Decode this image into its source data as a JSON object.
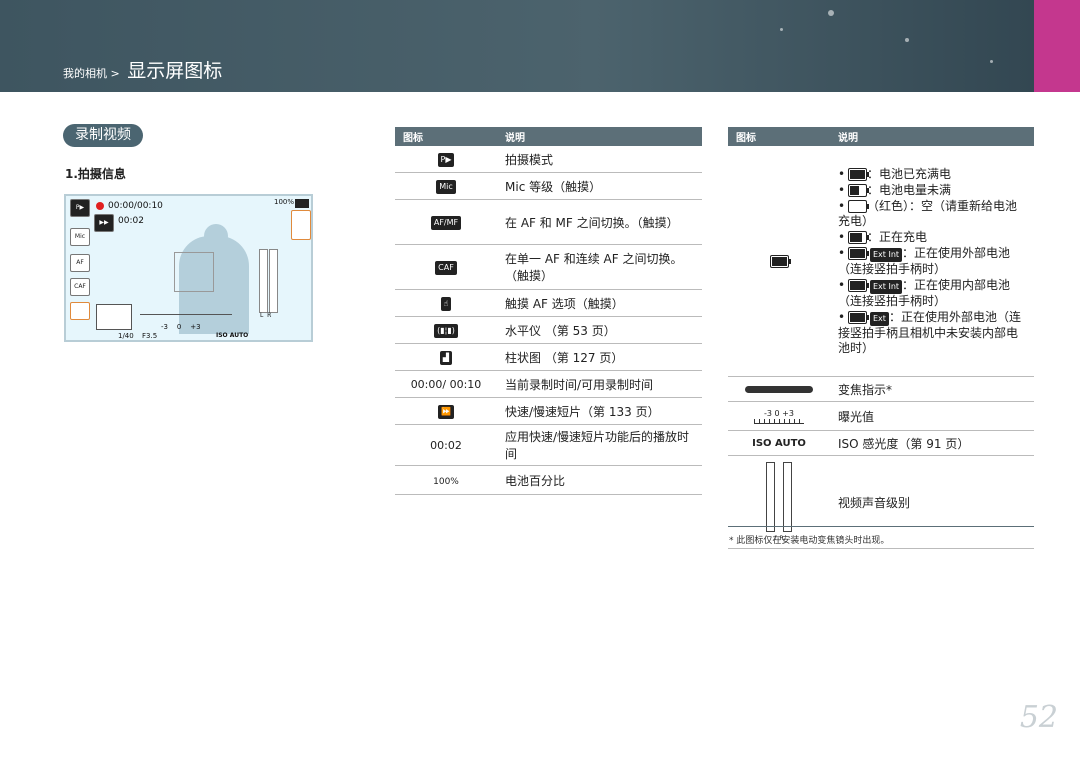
{
  "header": {
    "breadcrumb_small": "我的相机 >",
    "breadcrumb_big": "显示屏图标"
  },
  "section": {
    "title": "录制视频",
    "subtitle": "1.拍摄信息"
  },
  "screen": {
    "time_rec": "00:00/00:10",
    "time_clip": "00:02",
    "battery_pct": "100%",
    "shutter": "1/40",
    "aperture": "F3.5",
    "ev_scale": [
      "-3",
      "0",
      "+3"
    ],
    "iso": "ISO AUTO",
    "level_labels": [
      "L",
      "R"
    ]
  },
  "table_left": {
    "headers": [
      "图标",
      "说明"
    ],
    "rows": [
      {
        "icon": "P▶",
        "icon_name": "movie-mode-icon",
        "desc": "拍摄模式"
      },
      {
        "icon": "Mic",
        "icon_name": "mic-icon",
        "desc": "Mic 等级（触摸）"
      },
      {
        "icon": "AF/MF",
        "icon_name": "af-mf-icon",
        "desc": "在 AF 和 MF 之间切换。（触摸）"
      },
      {
        "icon": "CAF",
        "icon_name": "caf-icon",
        "desc": "在单一 AF 和连续 AF 之间切换。（触摸）"
      },
      {
        "icon": "☝",
        "icon_name": "touch-af-icon",
        "desc": "触摸 AF 选项（触摸）"
      },
      {
        "icon": "(▮¦▮)",
        "icon_name": "level-icon",
        "desc": "水平仪 （第 53 页）"
      },
      {
        "icon": "▟",
        "icon_name": "histogram-icon",
        "desc": "柱状图 （第 127 页）"
      },
      {
        "icon": "00:00/ 00:10",
        "icon_name": "rec-time-text",
        "desc": "当前录制时间/可用录制时间"
      },
      {
        "icon": "⏩",
        "icon_name": "fast-slow-icon",
        "desc": "快速/慢速短片（第 133 页）"
      },
      {
        "icon": "00:02",
        "icon_name": "clip-time-text",
        "desc": "应用快速/慢速短片功能后的播放时间"
      },
      {
        "icon": "100%",
        "icon_name": "battery-pct-text",
        "desc": "电池百分比"
      }
    ]
  },
  "table_right": {
    "headers": [
      "图标",
      "说明"
    ],
    "battery_lines": [
      {
        "text": "：电池已充满电",
        "badge": ""
      },
      {
        "text": "：电池电量未满",
        "badge": ""
      },
      {
        "text": "（红色）：空（请重新给电池充电）",
        "badge": ""
      },
      {
        "text": "：正在充电",
        "badge": ""
      },
      {
        "text": "：正在使用外部电池（连接竖拍手柄时）",
        "badge": "Ext Int"
      },
      {
        "text": "：正在使用内部电池（连接竖拍手柄时）",
        "badge": "Ext Int"
      },
      {
        "text": "：正在使用外部电池（连接竖拍手柄且相机中未安装内部电池时）",
        "badge": "Ext"
      }
    ],
    "rows": [
      {
        "icon_name": "zoom-bar-icon",
        "desc": "变焦指示*"
      },
      {
        "icon_name": "ev-scale-icon",
        "icon_text": "-3   0   +3",
        "desc": "曝光值"
      },
      {
        "icon_name": "iso-text",
        "icon_text": "ISO AUTO",
        "desc": "ISO 感光度（第 91 页）"
      },
      {
        "icon_name": "audio-level-icon",
        "icon_text": "L R",
        "desc": "视频声音级别"
      }
    ]
  },
  "footnote": "* 此图标仅在安装电动变焦镜头时出现。",
  "page_number": "52"
}
